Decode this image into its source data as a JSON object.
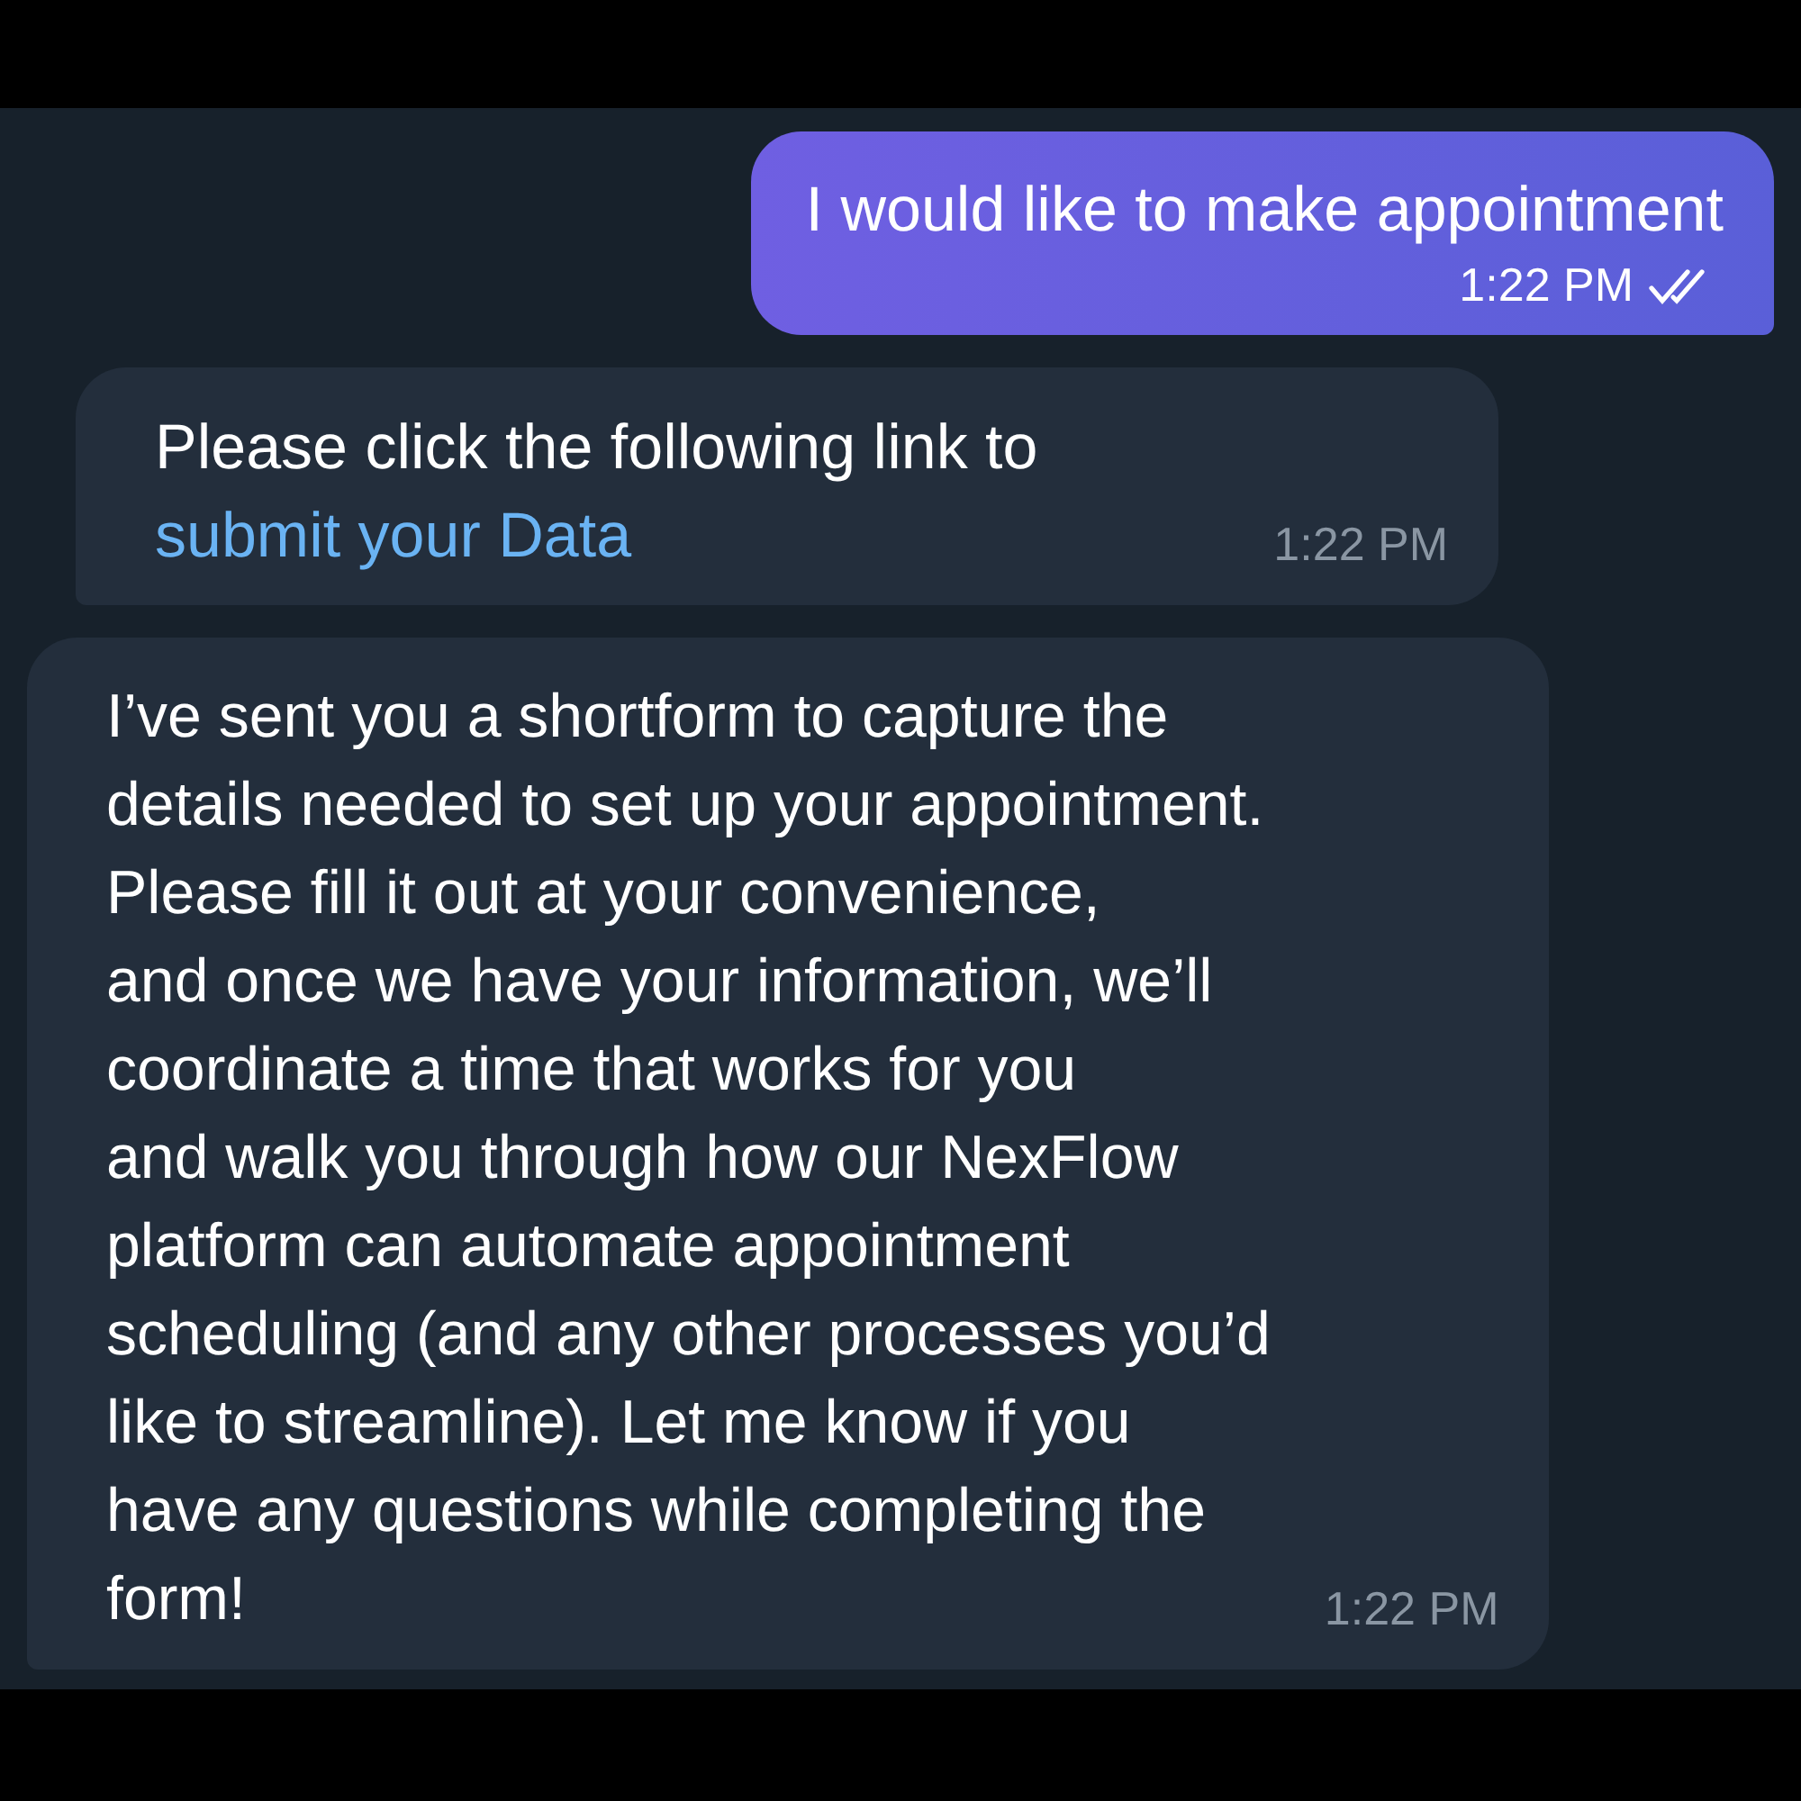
{
  "messages": [
    {
      "kind": "outgoing",
      "text": "I would like to make appointment",
      "time": "1:22 PM",
      "read": true
    },
    {
      "kind": "incoming",
      "text": "Please click the following link to ",
      "link": "submit your Data",
      "time": "1:22 PM"
    },
    {
      "kind": "incoming",
      "text": "I’ve sent you a shortform to capture the\ndetails needed to set up your appointment.\nPlease fill it out at your convenience,\nand once we have your information, we’ll\ncoordinate a time that works for you\nand walk you through how our NexFlow\nplatform can automate appointment\nscheduling (and any other processes you’d\nlike to streamline). Let me know if you\nhave any questions while completing the\nform!",
      "time": "1:22 PM"
    }
  ]
}
